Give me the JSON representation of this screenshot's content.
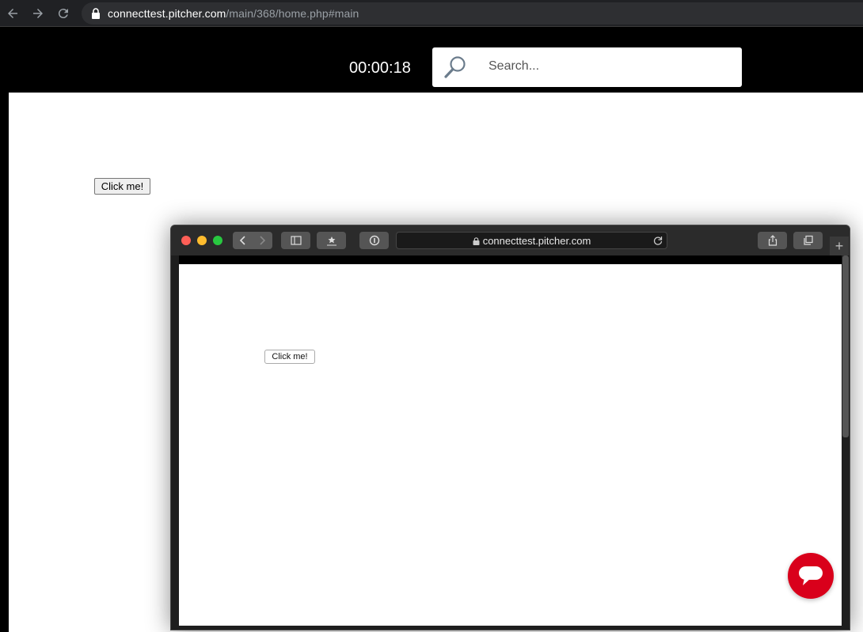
{
  "browser": {
    "url_host": "connecttest.pitcher.com",
    "url_path": "/main/368/home.php#main",
    "icons": [
      "back-arrow-icon",
      "forward-arrow-icon",
      "reload-icon",
      "lock-icon"
    ]
  },
  "header": {
    "timer": "00:00:18",
    "search_placeholder": "Search..."
  },
  "page": {
    "button_label": "Click me!"
  },
  "embedded_window": {
    "address": "connecttest.pitcher.com",
    "button_label": "Click me!",
    "new_tab_symbol": "+"
  },
  "colors": {
    "chat_accent": "#d9001b",
    "chrome_bar": "#202124",
    "header_bg": "#000000"
  }
}
